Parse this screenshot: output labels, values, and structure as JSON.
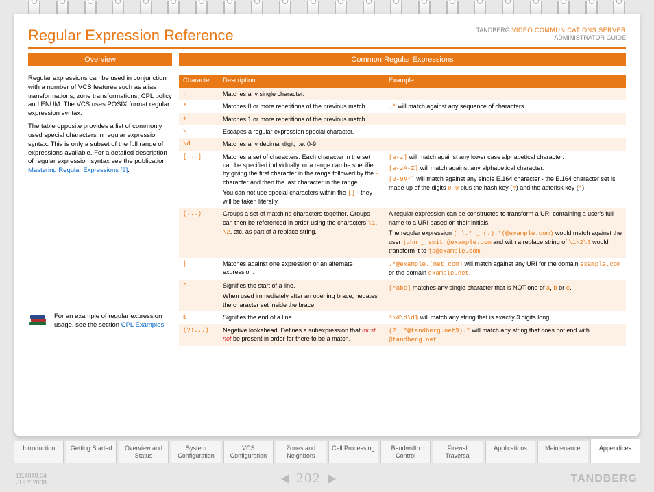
{
  "header": {
    "title": "Regular Expression Reference",
    "brand_line1_a": "TANDBERG ",
    "brand_line1_b": "VIDEO COMMUNICATIONS SERVER",
    "brand_line2": "ADMINISTRATOR GUIDE"
  },
  "sections": {
    "overview": "Overview",
    "common": "Common Regular Expressions"
  },
  "overview": {
    "p1": "Regular expressions can be used in conjunction with a number of VCS features such as alias transformations, zone transformations, CPL policy and ENUM. The VCS uses POSIX format regular expression syntax.",
    "p2a": "The table opposite provides a list of commonly used special characters in regular expression syntax. This is only a subset of the full range of expressions available. For a detailed description of regular expression syntax see the publication ",
    "p2_link": "Mastering Regular Expressions [9]",
    "p2b": "."
  },
  "callout": {
    "t1": "For an example of regular expression usage, see the section ",
    "link": "CPL Examples",
    "t2": "."
  },
  "table": {
    "h1": "Character",
    "h2": "Description",
    "h3": "Example",
    "rows": [
      {
        "c": ".",
        "d": [
          {
            "t": "Matches any single character."
          }
        ],
        "e": []
      },
      {
        "c": "*",
        "d": [
          {
            "t": "Matches 0 or more repetitions of the previous match."
          }
        ],
        "e": [
          {
            "parts": [
              {
                "m": ".*"
              },
              {
                "t": " will match against any sequence of characters."
              }
            ]
          }
        ]
      },
      {
        "c": "+",
        "d": [
          {
            "t": "Matches 1 or more repetitions of the previous match."
          }
        ],
        "e": []
      },
      {
        "c": "\\",
        "d": [
          {
            "t": "Escapes a regular expression special character."
          }
        ],
        "e": []
      },
      {
        "c": "\\d",
        "d": [
          {
            "t": "Matches any decimal digit, i.e. 0-9."
          }
        ],
        "e": []
      },
      {
        "c": "[...]",
        "d": [
          {
            "parts": [
              {
                "t": "Matches a set of characters. Each character in the set can be specified individually, or a range can be specified by giving the first character in the range followed by the "
              },
              {
                "m": "-"
              },
              {
                "t": " character and then the last character in the range."
              }
            ]
          },
          {
            "parts": [
              {
                "t": "You can not use special characters within the "
              },
              {
                "m": "[]"
              },
              {
                "t": " - they will be taken literally."
              }
            ]
          }
        ],
        "e": [
          {
            "parts": [
              {
                "m": "[a-z]"
              },
              {
                "t": " will match against any lower case alphabetical character."
              }
            ]
          },
          {
            "parts": [
              {
                "m": "[a-zA-Z]"
              },
              {
                "t": " will match against any alphabetical character."
              }
            ]
          },
          {
            "parts": [
              {
                "m": "[0-9#*]"
              },
              {
                "t": " will match against any single E.164 character - the E.164 character set is made up of the digits "
              },
              {
                "m": "0-9"
              },
              {
                "t": " plus the hash key ("
              },
              {
                "m": "#"
              },
              {
                "t": ") and the asterisk key ("
              },
              {
                "m": "*"
              },
              {
                "t": ")."
              }
            ]
          }
        ]
      },
      {
        "c": "(...)",
        "d": [
          {
            "parts": [
              {
                "t": "Groups a set of matching characters together. Groups can then be referenced in order using the characters "
              },
              {
                "m": "\\1"
              },
              {
                "t": ", "
              },
              {
                "m": "\\2"
              },
              {
                "t": ", etc. as part of a replace string."
              }
            ]
          }
        ],
        "e": [
          {
            "parts": [
              {
                "t": "A regular expression can be constructed to transform a URI containing a user's full name to a URI based on their initials."
              }
            ]
          },
          {
            "parts": [
              {
                "t": "The regular expression "
              },
              {
                "m": "(.).* _ (.).*(@example.com)"
              },
              {
                "t": " would match against the user "
              },
              {
                "m": "john _ smith@example.com"
              },
              {
                "t": " and with a replace string of "
              },
              {
                "m": "\\1\\2\\3"
              },
              {
                "t": " would transform it to "
              },
              {
                "m": "js@example.com"
              },
              {
                "t": "."
              }
            ]
          }
        ]
      },
      {
        "c": "|",
        "d": [
          {
            "t": "Matches against one expression or an alternate expression."
          }
        ],
        "e": [
          {
            "parts": [
              {
                "m": ".*@example.(net|com)"
              },
              {
                "t": " will match against any URI for the domain "
              },
              {
                "m": "example.com"
              },
              {
                "t": " or the domain "
              },
              {
                "m": "example.net"
              },
              {
                "t": "."
              }
            ]
          }
        ]
      },
      {
        "c": "^",
        "d": [
          {
            "t": "Signifies the start of a line."
          },
          {
            "t": "When used immediately after an opening brace, negates the character set inside the brace."
          }
        ],
        "e": [
          {
            "parts": []
          },
          {
            "parts": [
              {
                "m": "[^abc]"
              },
              {
                "t": " matches any single character that is NOT one of "
              },
              {
                "m": "a"
              },
              {
                "t": ", "
              },
              {
                "m": "b"
              },
              {
                "t": " or "
              },
              {
                "m": "c"
              },
              {
                "t": "."
              }
            ]
          }
        ]
      },
      {
        "c": "$",
        "d": [
          {
            "t": "Signifies the end of a line."
          }
        ],
        "e": [
          {
            "parts": [
              {
                "m": "^\\d\\d\\d$"
              },
              {
                "t": " will match any string that is exactly 3 digits long."
              }
            ]
          }
        ]
      },
      {
        "c": "(?!...)",
        "d": [
          {
            "parts": [
              {
                "t": "Negative lookahead. Defines a subexpression that "
              },
              {
                "ri": "must not"
              },
              {
                "t": " be present in order for there to be a match."
              }
            ]
          }
        ],
        "e": [
          {
            "parts": [
              {
                "m": "(?!.*@tandberg.net$).*"
              },
              {
                "t": " will match any string that does not end with "
              },
              {
                "m": "@tandberg.net"
              },
              {
                "t": "."
              }
            ]
          }
        ]
      }
    ]
  },
  "tabs": [
    {
      "label": "Introduction",
      "active": false
    },
    {
      "label": "Getting Started",
      "active": false
    },
    {
      "label": "Overview and Status",
      "active": false
    },
    {
      "label": "System Configuration",
      "active": false
    },
    {
      "label": "VCS Configuration",
      "active": false
    },
    {
      "label": "Zones and Neighbors",
      "active": false
    },
    {
      "label": "Call Processing",
      "active": false
    },
    {
      "label": "Bandwidth Control",
      "active": false
    },
    {
      "label": "Firewall Traversal",
      "active": false
    },
    {
      "label": "Applications",
      "active": false
    },
    {
      "label": "Maintenance",
      "active": false
    },
    {
      "label": "Appendices",
      "active": true
    }
  ],
  "footer": {
    "doc_id": "D14049.04",
    "date": "JULY 2008",
    "page": "202",
    "brand": "TANDBERG"
  }
}
